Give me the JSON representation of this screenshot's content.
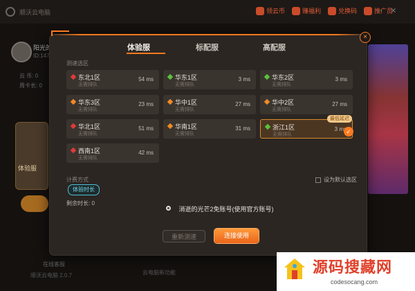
{
  "app": {
    "title": "顺沃云电脑",
    "top_links": [
      {
        "label": "领云币",
        "icon": "coin-icon"
      },
      {
        "label": "赚福利",
        "icon": "gift-icon"
      },
      {
        "label": "兑换码",
        "icon": "ticket-icon"
      },
      {
        "label": "推广员",
        "icon": "megaphone-icon"
      }
    ]
  },
  "background": {
    "user_name": "阳光的",
    "user_id": "ID:147",
    "stat1": "云 币:  0",
    "stat2": "周卡长:  0",
    "card_label": "体验服",
    "help": "在线客服",
    "version": "顺沃云电脑 2.0.7",
    "bottom": "云电脑新功能"
  },
  "modal": {
    "close": "×",
    "tabs": [
      {
        "label": "体验服",
        "active": true
      },
      {
        "label": "标配服",
        "active": false
      },
      {
        "label": "高配服",
        "active": false
      }
    ],
    "section_label": "测速选区",
    "servers": [
      {
        "name": "东北1区",
        "sub": "无需排队",
        "ms": "54 ms",
        "color": "#e03a3a"
      },
      {
        "name": "华东1区",
        "sub": "无需排队",
        "ms": "3 ms",
        "color": "#5ac23a"
      },
      {
        "name": "华东2区",
        "sub": "无需排队",
        "ms": "3 ms",
        "color": "#5ac23a"
      },
      {
        "name": "华东3区",
        "sub": "无需排队",
        "ms": "23 ms",
        "color": "#f08a24"
      },
      {
        "name": "华中1区",
        "sub": "无需排队",
        "ms": "27 ms",
        "color": "#f08a24"
      },
      {
        "name": "华中2区",
        "sub": "无需排队",
        "ms": "27 ms",
        "color": "#f08a24"
      },
      {
        "name": "华北1区",
        "sub": "无需排队",
        "ms": "51 ms",
        "color": "#e03a3a"
      },
      {
        "name": "华南1区",
        "sub": "无需排队",
        "ms": "31 ms",
        "color": "#f08a24"
      },
      {
        "name": "浙江1区",
        "sub": "无需排队",
        "ms": "3 ms",
        "color": "#5ac23a",
        "selected": true
      },
      {
        "name": "西南1区",
        "sub": "无需排队",
        "ms": "42 ms",
        "color": "#e03a3a"
      }
    ],
    "lowest_tag": "最低延迟",
    "billing_label": "计费方式",
    "default_checkbox": "设为默认选区",
    "billing_pill": "体验时长",
    "remaining": "剩余时长: 0",
    "account_text": "消逝的光芒2免账号(使用官方账号)",
    "retest_button": "重新测速",
    "connect_button": "连接使用"
  },
  "watermark": {
    "cn": "源码搜藏网",
    "url": "codesocang.com"
  }
}
